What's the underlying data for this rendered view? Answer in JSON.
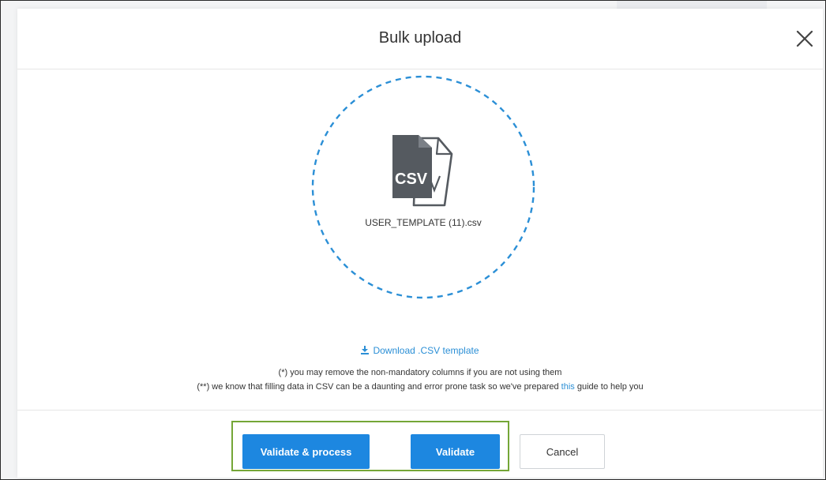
{
  "modal": {
    "title": "Bulk upload",
    "close_icon": "close-icon"
  },
  "dropzone": {
    "file_icon": "csv-file-icon",
    "file_type_label": "CSV",
    "file_name": "USER_TEMPLATE (11).csv",
    "border_color": "#2b8fd6"
  },
  "help": {
    "download_icon": "download-icon",
    "download_label": "Download .CSV template",
    "note_optional": "(*) you may remove the non-mandatory columns if you are not using them",
    "note_guide_prefix": "(**) we know that filling data in CSV can be a daunting and error prone task so we've prepared ",
    "note_guide_link": "this",
    "note_guide_suffix": " guide to help you"
  },
  "footer": {
    "validate_process_label": "Validate & process",
    "validate_label": "Validate",
    "cancel_label": "Cancel",
    "highlight_color": "#74a637",
    "primary_color": "#1d87e0"
  }
}
